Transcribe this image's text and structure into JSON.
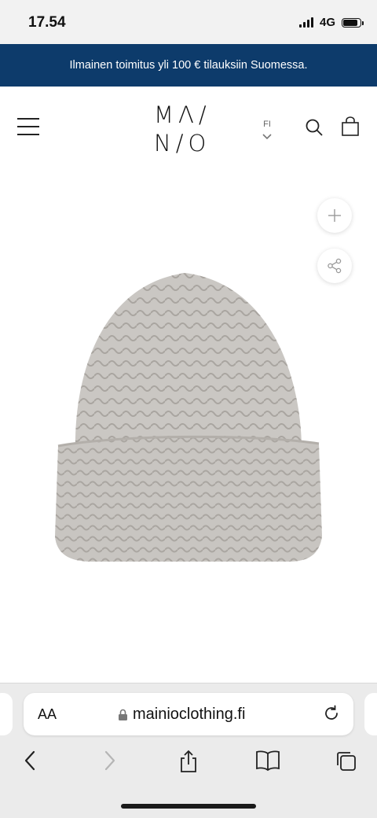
{
  "status": {
    "time": "17.54",
    "network": "4G",
    "battery_level": 0.85
  },
  "banner": {
    "text": "Ilmainen toimitus yli 100 € tilauksiin Suomessa."
  },
  "header": {
    "logo_line1": "MΛ/",
    "logo_line2": "N/O",
    "language": "FI"
  },
  "product": {
    "image_alt": "beanie"
  },
  "browser": {
    "text_size_label": "AA",
    "url": "mainioclothing.fi"
  },
  "icons": [
    "menu-icon",
    "chevron-down-icon",
    "search-icon",
    "bag-icon",
    "plus-icon",
    "share-icon",
    "lock-icon",
    "reload-icon",
    "back-icon",
    "forward-icon",
    "share-sheet-icon",
    "bookmarks-icon",
    "tabs-icon"
  ],
  "colors": {
    "banner": "#0d3b6b",
    "hat": "#c9c6c2",
    "browser_bg": "#ebebeb"
  }
}
